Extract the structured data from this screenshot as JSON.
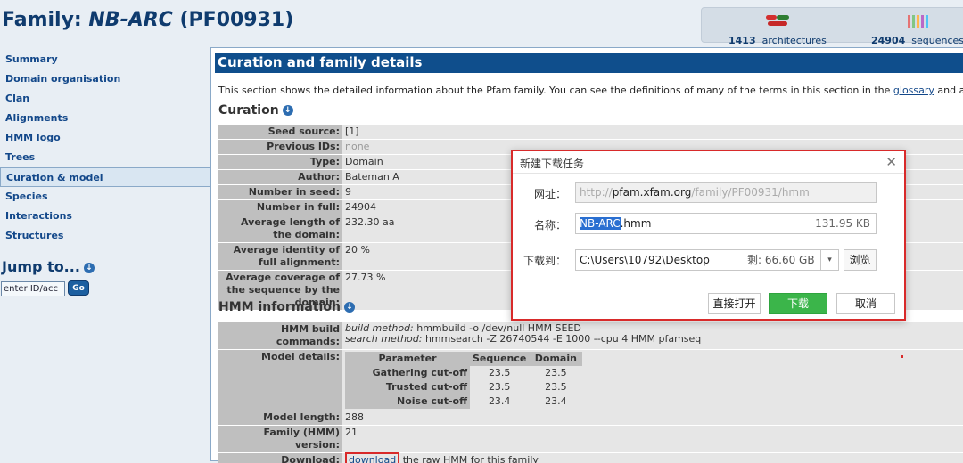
{
  "header": {
    "title_prefix": "Family: ",
    "title_family": "NB-ARC",
    "title_acc": " (PF00931)",
    "stats": [
      {
        "count": "1413",
        "label": "architectures",
        "icon": "architecture-icon"
      },
      {
        "count": "24904",
        "label": "sequences",
        "icon": "sequences-icon"
      }
    ]
  },
  "sidebar": {
    "items": [
      {
        "label": "Summary"
      },
      {
        "label": "Domain organisation"
      },
      {
        "label": "Clan"
      },
      {
        "label": "Alignments"
      },
      {
        "label": "HMM logo"
      },
      {
        "label": "Trees"
      },
      {
        "label": "Curation & model",
        "active": true
      },
      {
        "label": "Species"
      },
      {
        "label": "Interactions"
      },
      {
        "label": "Structures"
      }
    ],
    "jump_title": "Jump to...",
    "jump_placeholder": "enter ID/acc",
    "go_label": "Go"
  },
  "main": {
    "section_title": "Curation and family details",
    "intro_text": "This section shows the detailed information about the Pfam family. You can see the definitions of many of the terms in this section in the ",
    "intro_link": "glossary",
    "intro_tail": " and a fuller",
    "curation_heading": "Curation",
    "curation": [
      {
        "key": "Seed source:",
        "value": "[1]"
      },
      {
        "key": "Previous IDs:",
        "value": "none",
        "muted": true
      },
      {
        "key": "Type:",
        "value": "Domain"
      },
      {
        "key": "Author:",
        "value": "Bateman A"
      },
      {
        "key": "Number in seed:",
        "value": "9"
      },
      {
        "key": "Number in full:",
        "value": "24904"
      },
      {
        "key": "Average length of the domain:",
        "value": "232.30 aa"
      },
      {
        "key": "Average identity of full alignment:",
        "value": "20 %"
      },
      {
        "key": "Average coverage of the sequence by the domain:",
        "value": "27.73 %"
      }
    ],
    "hmm_heading": "HMM information",
    "hmm": {
      "build_key": "HMM build commands:",
      "build_method_label": "build method:",
      "build_method": " hmmbuild -o /dev/null HMM SEED",
      "search_method_label": "search method:",
      "search_method": " hmmsearch -Z 26740544 -E 1000 --cpu 4 HMM pfamseq",
      "model_details_key": "Model details:",
      "cutoff_headers": [
        "Parameter",
        "Sequence",
        "Domain"
      ],
      "cutoffs": [
        {
          "param": "Gathering cut-off",
          "sequence": "23.5",
          "domain": "23.5"
        },
        {
          "param": "Trusted cut-off",
          "sequence": "23.5",
          "domain": "23.5"
        },
        {
          "param": "Noise cut-off",
          "sequence": "23.4",
          "domain": "23.4"
        }
      ],
      "model_length_key": "Model length:",
      "model_length": "288",
      "version_key": "Family (HMM) version:",
      "version": "21",
      "download_key": "Download:",
      "download_link": "download",
      "download_tail": " the raw HMM for this family"
    }
  },
  "dialog": {
    "title": "新建下载任务",
    "url_label": "网址：",
    "url_scheme": "http://",
    "url_host": "pfam.xfam.org",
    "url_path": "/family/PF00931/hmm",
    "name_label": "名称：",
    "name_selected": "NB-ARC",
    "name_ext": ".hmm",
    "file_size": "131.95 KB",
    "save_label": "下载到：",
    "save_path": "C:\\Users\\10792\\Desktop",
    "free_space": "剩: 66.60 GB",
    "browse_label": "浏览",
    "open_label": "直接打开",
    "download_label": "下载",
    "cancel_label": "取消",
    "close_glyph": "✕"
  },
  "colors": {
    "brand": "#0f4e8c",
    "highlight_box": "#d82a2a",
    "download_button": "#3bb54a"
  }
}
